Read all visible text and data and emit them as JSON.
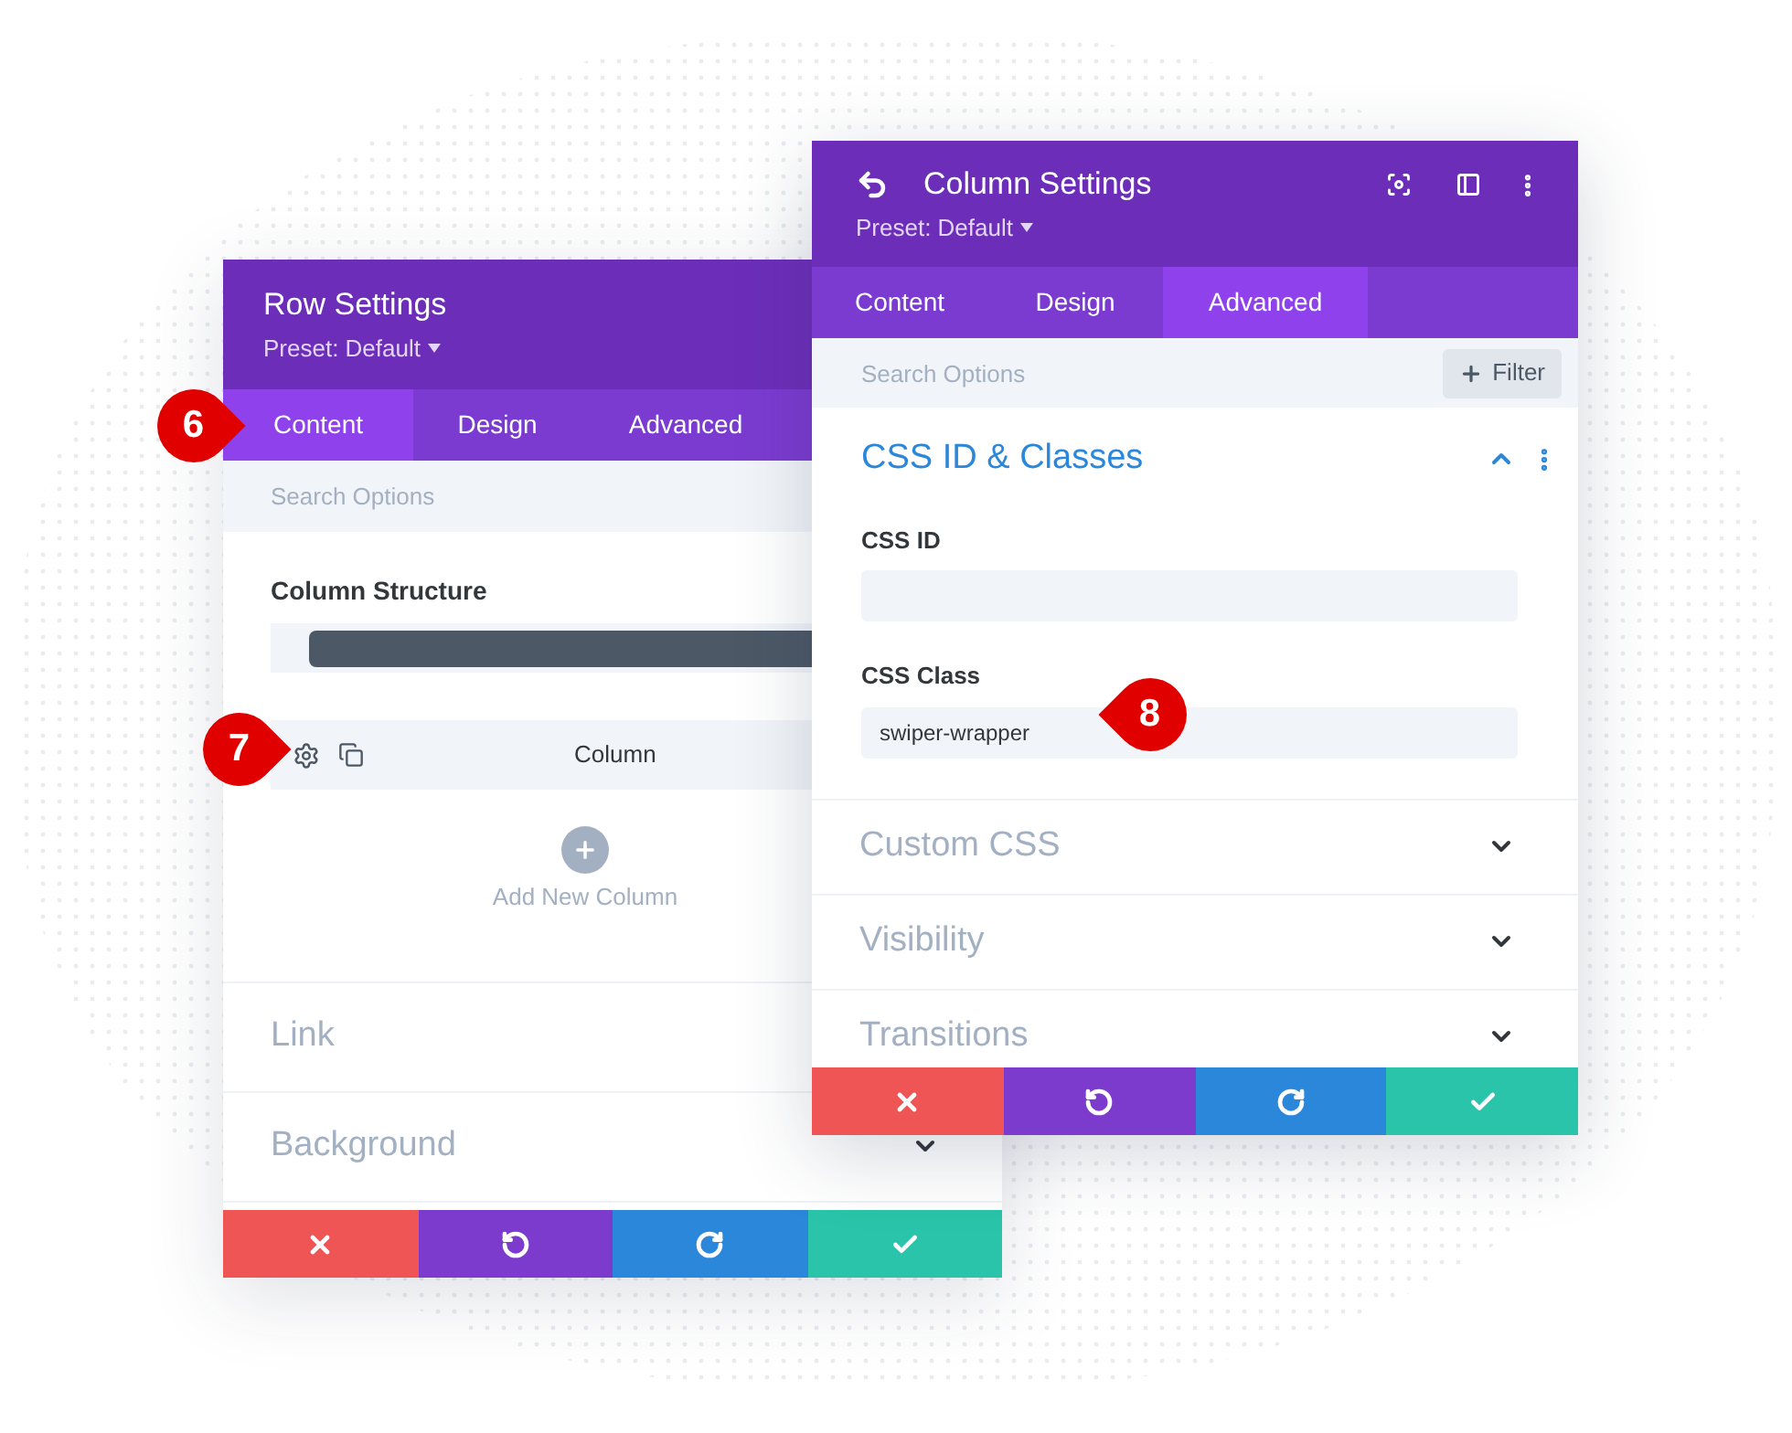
{
  "row_settings": {
    "title": "Row Settings",
    "preset": "Preset: Default",
    "tabs": [
      {
        "label": "Content",
        "selected": true
      },
      {
        "label": "Design",
        "selected": false
      },
      {
        "label": "Advanced",
        "selected": false
      }
    ],
    "search": {
      "placeholder": "Search Options"
    },
    "column_structure": {
      "label": "Column Structure"
    },
    "column_item": {
      "label": "Column"
    },
    "add_column": {
      "label": "Add New Column"
    },
    "sections": [
      {
        "title": "Link"
      },
      {
        "title": "Background",
        "expanded": false
      }
    ],
    "footer": [
      {
        "kind": "discard"
      },
      {
        "kind": "undo"
      },
      {
        "kind": "redo"
      },
      {
        "kind": "save"
      }
    ]
  },
  "column_settings": {
    "title": "Column Settings",
    "preset": "Preset: Default",
    "tabs": [
      {
        "label": "Content",
        "selected": false
      },
      {
        "label": "Design",
        "selected": false
      },
      {
        "label": "Advanced",
        "selected": true
      }
    ],
    "search": {
      "placeholder": "Search Options"
    },
    "filter_button": "Filter",
    "open_section": {
      "title": "CSS ID & Classes",
      "expanded": true,
      "fields": [
        {
          "label": "CSS ID"
        },
        {
          "label": "CSS Class",
          "value": "swiper-wrapper"
        }
      ]
    },
    "sections": [
      {
        "title": "Custom CSS",
        "expanded": false
      },
      {
        "title": "Visibility",
        "expanded": false
      },
      {
        "title": "Transitions",
        "expanded": false
      }
    ],
    "footer": [
      {
        "kind": "discard"
      },
      {
        "kind": "undo"
      },
      {
        "kind": "redo"
      },
      {
        "kind": "save"
      }
    ]
  },
  "callouts": [
    {
      "number": "6"
    },
    {
      "number": "7"
    },
    {
      "number": "8"
    }
  ]
}
